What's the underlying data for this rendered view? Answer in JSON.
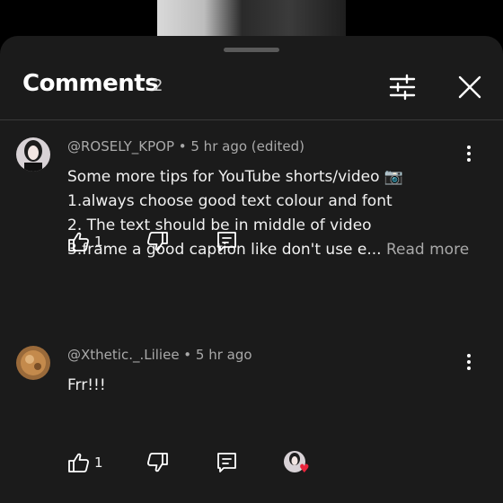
{
  "header": {
    "title": "Comments",
    "count": "2"
  },
  "icons": {
    "filter": "sliders-icon",
    "close": "close-icon",
    "more": "more-vert-icon",
    "like": "thumb-up-icon",
    "dislike": "thumb-down-icon",
    "reply": "reply-icon",
    "heart": "heart-icon"
  },
  "comments": [
    {
      "author_meta": "@ROSELY_KPOP • 5 hr ago (edited)",
      "lines": [
        "Some more tips for YouTube shorts/video 📷",
        "1.always choose good text colour and font",
        "2. The text should be in middle of video",
        "3.frame a good caption like don't use e..."
      ],
      "read_more": "Read more",
      "likes": "1"
    },
    {
      "author_meta": "@Xthetic._.Liliee • 5 hr ago",
      "lines": [
        "Frr!!!"
      ],
      "likes": "1",
      "hearted": true
    }
  ],
  "colors": {
    "sheet_bg": "#1b1b1b",
    "heart": "#e8243b",
    "muted_text": "#a9a9a9"
  }
}
